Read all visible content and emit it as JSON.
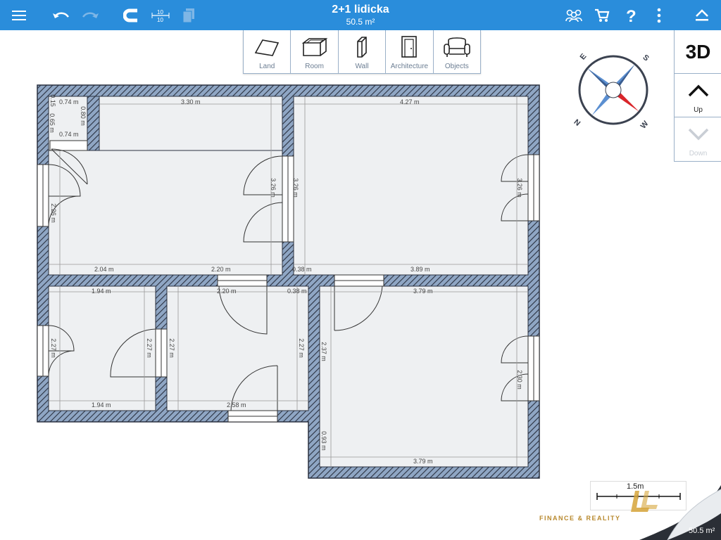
{
  "header": {
    "title": "2+1 lidicka",
    "subtitle": "50.5 m²"
  },
  "toolbar": [
    {
      "label": "Land",
      "icon": "land-icon"
    },
    {
      "label": "Room",
      "icon": "room-icon"
    },
    {
      "label": "Wall",
      "icon": "wall-icon"
    },
    {
      "label": "Architecture",
      "icon": "door-icon"
    },
    {
      "label": "Objects",
      "icon": "armchair-icon"
    }
  ],
  "right_panel": {
    "view_3d": "3D",
    "up": "Up",
    "down": "Down"
  },
  "compass": {
    "n": "N",
    "s": "S",
    "e": "E",
    "w": "W"
  },
  "dimensions": {
    "d1": "0.74 m",
    "d2": "0.15",
    "d3": "0.65 m",
    "d4": "0.80 m",
    "d5": "0.74 m",
    "d6": "3.30 m",
    "d7": "4.27 m",
    "d8": "3.26 m",
    "d9": "3.26 m",
    "d10": "3.26 m",
    "d11": "2.26 m",
    "d12": "2.04 m",
    "d13": "2.20 m",
    "d14": "0.38 m",
    "d15": "3.89 m",
    "d16": "1.94 m",
    "d17": "2.20 m",
    "d18": "0.38 m",
    "d19": "3.79 m",
    "d20": "2.27 m",
    "d21": "2.27 m",
    "d22": "2.27 m",
    "d23": "2.27 m",
    "d24": "2.37 m",
    "d25": "2.30 m",
    "d26": "1.94 m",
    "d27": "2.58 m",
    "d28": "0.93 m",
    "d29": "3.79 m"
  },
  "scale": {
    "label": "1.5m"
  },
  "watermark": {
    "text": "FINANCE & REALITY"
  },
  "footer": {
    "area": "50.5 m²"
  },
  "colors": {
    "topbar": "#2a8ddb",
    "wall": "#8fa6c4",
    "floor": "#eef0f2",
    "compass_red": "#d9252a"
  }
}
